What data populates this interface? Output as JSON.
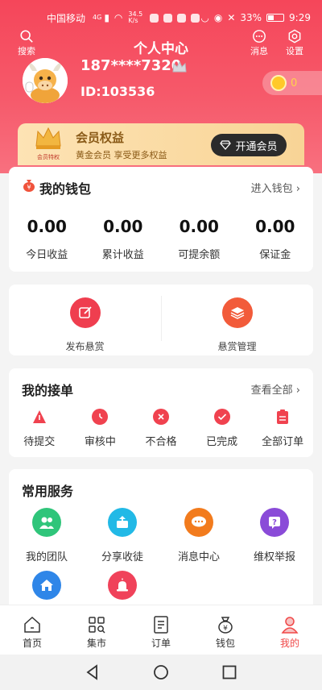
{
  "status_bar": {
    "carrier": "中国移动",
    "net_type": "4G",
    "speed_value": "34.5",
    "speed_unit": "K/s",
    "battery": "33%",
    "time": "9:29"
  },
  "topnav": {
    "search_label": "搜索",
    "title": "个人中心",
    "message_label": "消息",
    "settings_label": "设置"
  },
  "profile": {
    "phone": "187****7320",
    "user_id": "ID:103536",
    "coins": "0"
  },
  "membership": {
    "badge_text": "会员特权",
    "title": "会员权益",
    "subtitle": "黄金会员 享受更多权益",
    "button": "开通会员"
  },
  "wallet": {
    "title": "我的钱包",
    "link": "进入钱包",
    "stats": [
      {
        "value": "0.00",
        "label": "今日收益"
      },
      {
        "value": "0.00",
        "label": "累计收益"
      },
      {
        "value": "0.00",
        "label": "可提余额"
      },
      {
        "value": "0.00",
        "label": "保证金"
      }
    ]
  },
  "bounty": {
    "items": [
      {
        "label": "发布悬赏"
      },
      {
        "label": "悬赏管理"
      }
    ]
  },
  "orders": {
    "title": "我的接单",
    "link": "查看全部",
    "items": [
      {
        "label": "待提交"
      },
      {
        "label": "审核中"
      },
      {
        "label": "不合格"
      },
      {
        "label": "已完成"
      },
      {
        "label": "全部订单"
      }
    ]
  },
  "services": {
    "title": "常用服务",
    "items": [
      {
        "label": "我的团队"
      },
      {
        "label": "分享收徒"
      },
      {
        "label": "消息中心"
      },
      {
        "label": "维权举报"
      },
      {
        "label": ""
      },
      {
        "label": ""
      }
    ]
  },
  "tabbar": {
    "items": [
      {
        "label": "首页"
      },
      {
        "label": "集市"
      },
      {
        "label": "订单"
      },
      {
        "label": "钱包",
        "icon_text": "¥"
      },
      {
        "label": "我的"
      }
    ]
  },
  "colors": {
    "brand_red": "#f5465a",
    "active_tab": "#f04848",
    "gold": "#f8d496"
  }
}
